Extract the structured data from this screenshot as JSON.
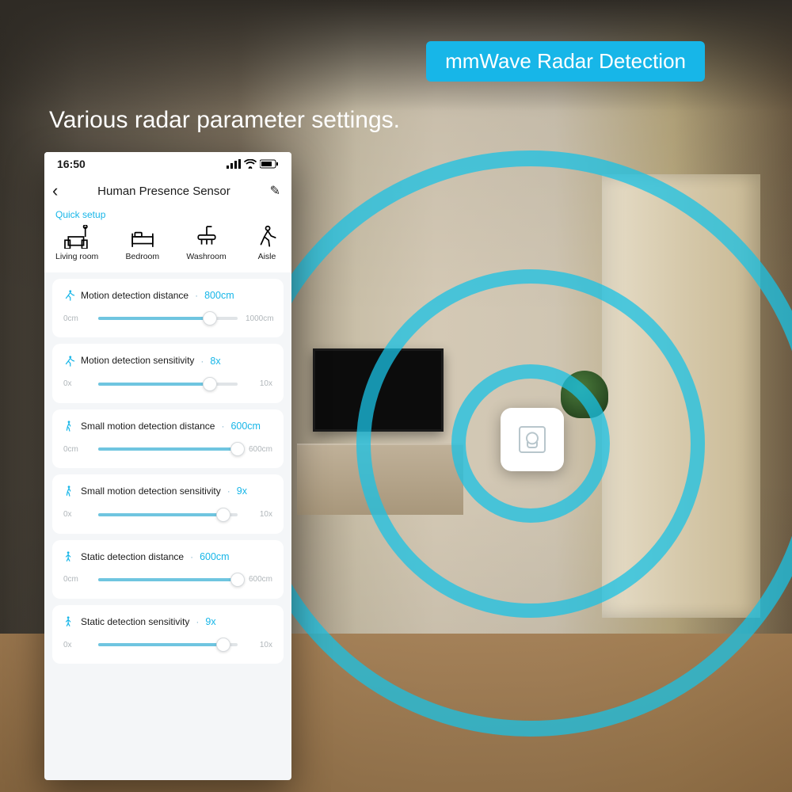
{
  "badge": "mmWave Radar Detection",
  "headline": "Various radar parameter settings.",
  "status": {
    "time": "16:50"
  },
  "header": {
    "back": "‹",
    "title": "Human Presence Sensor",
    "edit": "✎"
  },
  "quick_setup": {
    "label": "Quick setup",
    "rooms": [
      {
        "key": "living",
        "label": "Living room"
      },
      {
        "key": "bedroom",
        "label": "Bedroom"
      },
      {
        "key": "washroom",
        "label": "Washroom"
      },
      {
        "key": "aisle",
        "label": "Aisle"
      }
    ]
  },
  "sliders": [
    {
      "icon": "run",
      "title": "Motion detection distance",
      "value": "800cm",
      "min": "0cm",
      "max": "1000cm",
      "pct": 80
    },
    {
      "icon": "run",
      "title": "Motion detection sensitivity",
      "value": "8x",
      "min": "0x",
      "max": "10x",
      "pct": 80
    },
    {
      "icon": "walk",
      "title": "Small motion detection distance",
      "value": "600cm",
      "min": "0cm",
      "max": "600cm",
      "pct": 100
    },
    {
      "icon": "walk",
      "title": "Small motion detection sensitivity",
      "value": "9x",
      "min": "0x",
      "max": "10x",
      "pct": 90
    },
    {
      "icon": "stand",
      "title": "Static detection distance",
      "value": "600cm",
      "min": "0cm",
      "max": "600cm",
      "pct": 100
    },
    {
      "icon": "stand",
      "title": "Static detection sensitivity",
      "value": "9x",
      "min": "0x",
      "max": "10x",
      "pct": 90
    }
  ],
  "colors": {
    "accent": "#17b6e8"
  }
}
